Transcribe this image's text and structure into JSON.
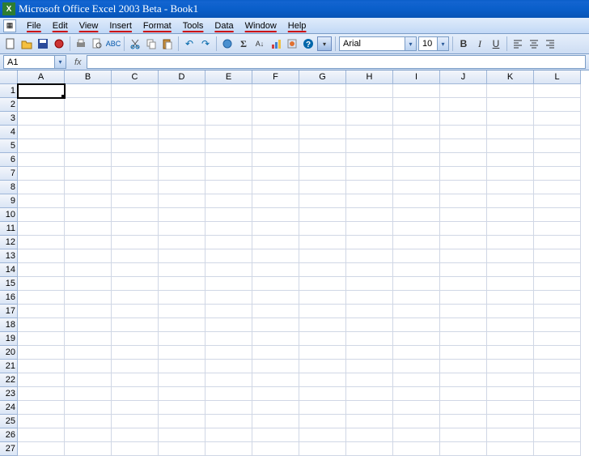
{
  "title": "Microsoft Office Excel 2003 Beta - Book1",
  "menu": [
    "File",
    "Edit",
    "View",
    "Insert",
    "Format",
    "Tools",
    "Data",
    "Window",
    "Help"
  ],
  "toolbar_icons": {
    "new": "◫",
    "open": "📂",
    "save": "💾",
    "mail": "✉",
    "print": "⎙",
    "preview": "🔍",
    "spell": "✔",
    "cut": "✂",
    "copy": "⧉",
    "paste": "📋",
    "undo": "↶",
    "redo": "↷",
    "link": "🔗",
    "sum": "Σ",
    "sort": "A↓",
    "chart": "📊",
    "help": "?"
  },
  "font_name": "Arial",
  "font_size": "10",
  "format_buttons": {
    "bold": "B",
    "italic": "I",
    "underline": "U",
    "left": "≡",
    "center": "≡",
    "right": "≡"
  },
  "name_box": "A1",
  "fx_label": "fx",
  "formula_value": "",
  "columns": [
    "A",
    "B",
    "C",
    "D",
    "E",
    "F",
    "G",
    "H",
    "I",
    "J",
    "K",
    "L"
  ],
  "row_count": 27,
  "active_cell": {
    "row": 1,
    "col": "A"
  }
}
